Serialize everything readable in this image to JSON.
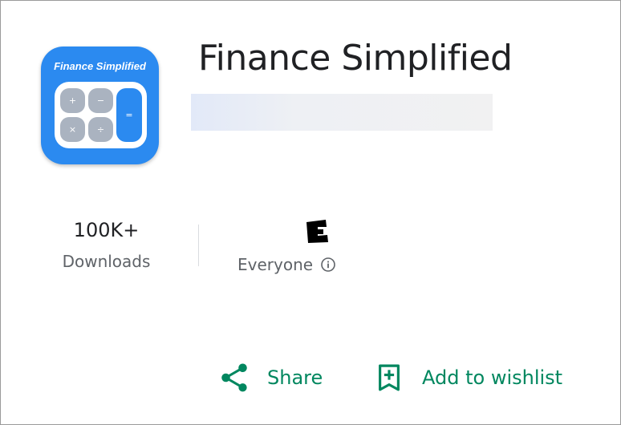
{
  "app": {
    "title": "Finance Simplified",
    "icon": {
      "name": "finance-simplified-app-icon",
      "label": "Finance Simplified",
      "keys": [
        "+",
        "−",
        "×",
        "÷",
        "="
      ],
      "color": "#2b8af0"
    }
  },
  "stats": {
    "downloads": {
      "value": "100K+",
      "label": "Downloads"
    },
    "rating": {
      "badge": "E",
      "label": "Everyone",
      "icon": "info-icon"
    }
  },
  "actions": {
    "share": {
      "label": "Share",
      "icon": "share-icon"
    },
    "wishlist": {
      "label": "Add to wishlist",
      "icon": "bookmark-add-icon"
    }
  },
  "colors": {
    "accent": "#01875f",
    "title": "#202124",
    "secondary_text": "#5f6368"
  }
}
